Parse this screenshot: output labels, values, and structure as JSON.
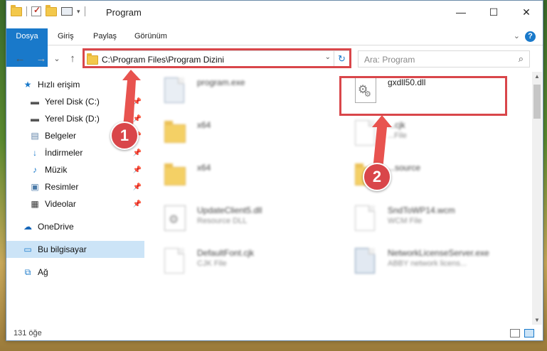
{
  "window": {
    "title": "Program",
    "minimize": "—",
    "maximize": "☐",
    "close": "✕"
  },
  "ribbon": {
    "tabs": [
      "Dosya",
      "Giriş",
      "Paylaş",
      "Görünüm"
    ],
    "help": "?"
  },
  "nav": {
    "back": "←",
    "forward": "→",
    "recent": "⌄",
    "up": "↑",
    "address": "C:\\Program Files\\Program Dizini",
    "search_placeholder": "Ara: Program"
  },
  "sidebar": {
    "items": [
      {
        "label": "Hızlı erişim",
        "icon": "star-icon"
      },
      {
        "label": "Yerel Disk (C:)",
        "icon": "drive-icon"
      },
      {
        "label": "Yerel Disk (D:)",
        "icon": "drive-icon"
      },
      {
        "label": "Belgeler",
        "icon": "documents-icon"
      },
      {
        "label": "İndirmeler",
        "icon": "download-icon"
      },
      {
        "label": "Müzik",
        "icon": "music-icon"
      },
      {
        "label": "Resimler",
        "icon": "pictures-icon"
      },
      {
        "label": "Videolar",
        "icon": "videos-icon"
      },
      {
        "label": "OneDrive",
        "icon": "cloud-icon"
      },
      {
        "label": "Bu bilgisayar",
        "icon": "computer-icon"
      },
      {
        "label": "Ağ",
        "icon": "network-icon"
      }
    ]
  },
  "files": [
    {
      "name": "program.exe",
      "type": ""
    },
    {
      "name": "gxdll50.dll",
      "type": ""
    },
    {
      "name": "x64",
      "type": ""
    },
    {
      "name": "...cjk",
      "type": "...File"
    },
    {
      "name": "x64",
      "type": ""
    },
    {
      "name": "...source",
      "type": ""
    },
    {
      "name": "UpdateClient5.dll",
      "type": "Resource DLL"
    },
    {
      "name": "SndToWP14.wcm",
      "type": "WCM File"
    },
    {
      "name": "DefaultFont.cjk",
      "type": "CJK File"
    },
    {
      "name": "NetworkLicenseServer.exe",
      "type": "ABBY network licens..."
    }
  ],
  "annotations": {
    "badge1": "1",
    "badge2": "2"
  },
  "status": {
    "count": "131 öğe"
  },
  "colors": {
    "accent": "#1979ca",
    "highlight": "#d9464a",
    "selected": "#cce4f7"
  }
}
